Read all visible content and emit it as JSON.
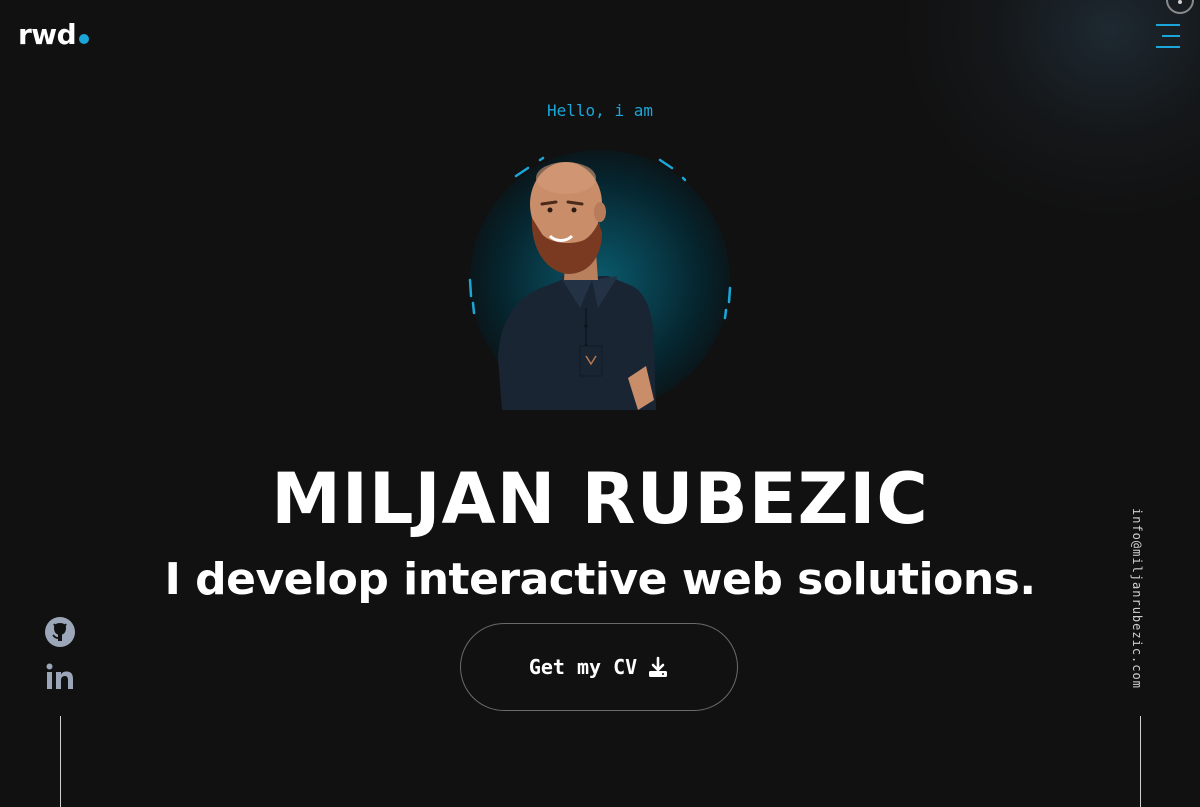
{
  "header": {
    "logo_text": "rwd",
    "menu_icon": "hamburger-menu-icon"
  },
  "hero": {
    "greeting": "Hello, i am",
    "name": "MILJAN RUBEZIC",
    "tagline": "I develop interactive web solutions.",
    "cv_button_label": "Get my CV",
    "cv_icon": "download-icon"
  },
  "social": {
    "items": [
      {
        "name": "github",
        "icon": "github-icon"
      },
      {
        "name": "linkedin",
        "icon": "linkedin-icon"
      }
    ]
  },
  "contact": {
    "email": "info@miljanrubezic.com"
  },
  "colors": {
    "background": "#111111",
    "accent": "#1ba6d8",
    "text": "#ffffff"
  }
}
